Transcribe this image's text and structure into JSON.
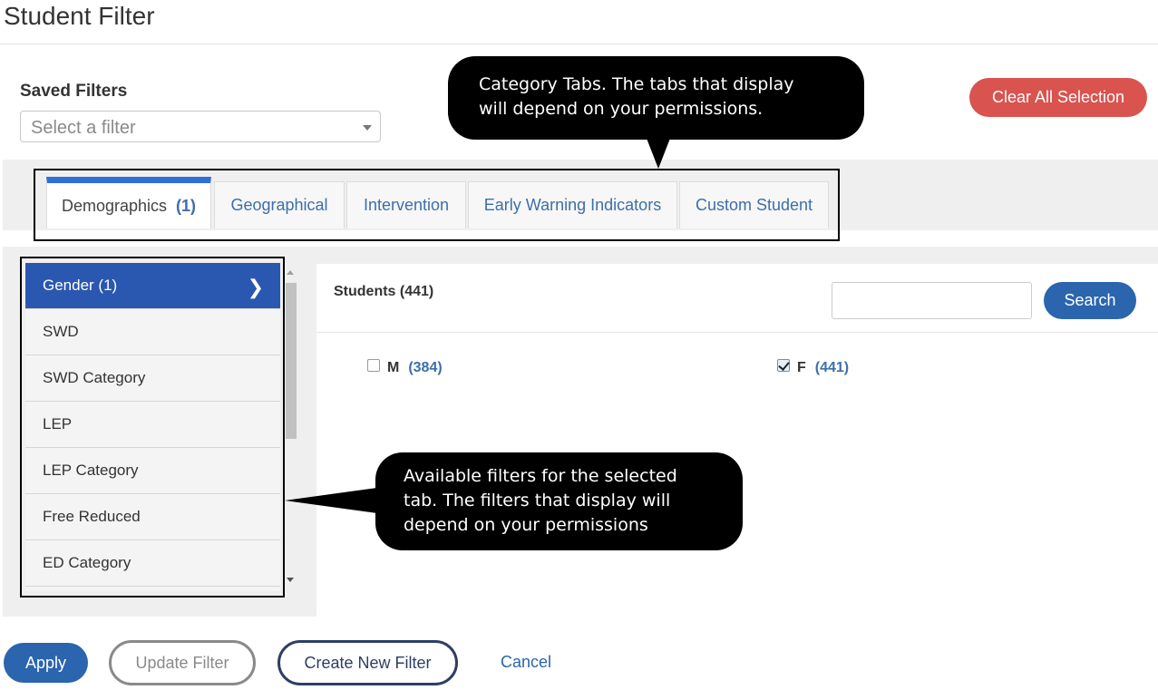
{
  "header": {
    "title": "Student Filter"
  },
  "saved_filters": {
    "label": "Saved Filters",
    "placeholder": "Select a filter"
  },
  "clear_all": {
    "label": "Clear All Selection"
  },
  "tabs": [
    {
      "label": "Demographics",
      "count": "(1)",
      "active": true
    },
    {
      "label": "Geographical"
    },
    {
      "label": "Intervention"
    },
    {
      "label": "Early Warning Indicators"
    },
    {
      "label": "Custom Student"
    }
  ],
  "filters": [
    {
      "label": "Gender (1)",
      "active": true
    },
    {
      "label": "SWD"
    },
    {
      "label": "SWD Category"
    },
    {
      "label": "LEP"
    },
    {
      "label": "LEP Category"
    },
    {
      "label": "Free Reduced"
    },
    {
      "label": "ED Category"
    }
  ],
  "content": {
    "heading": "Students (441)",
    "search_label": "Search",
    "options": [
      {
        "label": "M",
        "count": "(384)",
        "checked": false
      },
      {
        "label": "F",
        "count": "(441)",
        "checked": true
      }
    ]
  },
  "callouts": {
    "tabs_line1": "Category Tabs. The tabs that display",
    "tabs_line2": "will depend on your permissions.",
    "filters_line1": "Available filters for the selected",
    "filters_line2": "tab. The filters that display will",
    "filters_line3": "depend on your permissions"
  },
  "footer": {
    "apply": "Apply",
    "update": "Update Filter",
    "create": "Create New Filter",
    "cancel": "Cancel"
  },
  "colors": {
    "accent_blue": "#2a65ad",
    "active_filter": "#2a58b0",
    "clear_red": "#d9534f",
    "link_blue": "#3d6fa8"
  },
  "icons": {
    "select_caret": "caret-down-icon",
    "filter_chevron": "chevron-right-icon",
    "scroll_up": "scroll-up-icon",
    "scroll_down": "scroll-down-icon"
  }
}
